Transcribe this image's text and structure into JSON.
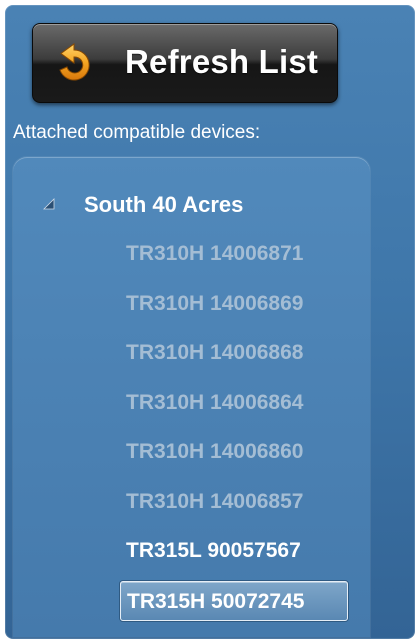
{
  "toolbar": {
    "refresh_label": "Refresh List",
    "refresh_icon": "refresh-arrow-icon"
  },
  "section": {
    "label": "Attached compatible devices:"
  },
  "tree": {
    "group": {
      "label": "South 40 Acres",
      "expanded": true,
      "toggle_icon": "tree-expanded-triangle-icon"
    },
    "devices": [
      {
        "label": "TR310H 14006871",
        "state": "inactive"
      },
      {
        "label": "TR310H 14006869",
        "state": "inactive"
      },
      {
        "label": "TR310H 14006868",
        "state": "inactive"
      },
      {
        "label": "TR310H 14006864",
        "state": "inactive"
      },
      {
        "label": "TR310H 14006860",
        "state": "inactive"
      },
      {
        "label": "TR310H 14006857",
        "state": "inactive"
      },
      {
        "label": "TR315L 90057567",
        "state": "active"
      },
      {
        "label": "TR315H 50072745",
        "state": "selected"
      }
    ]
  },
  "colors": {
    "panel_blue": "#4a80b2",
    "inactive_text": "#a4bdd4",
    "active_text": "#ffffff",
    "refresh_arrow": "#f5a623"
  }
}
